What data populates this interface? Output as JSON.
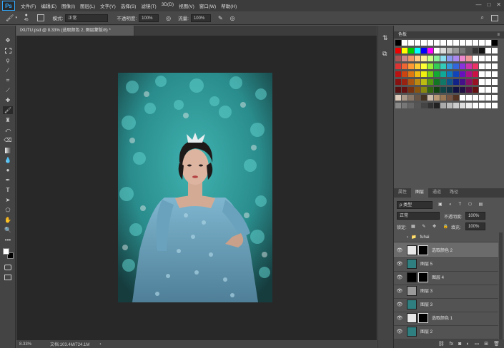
{
  "app": {
    "logo": "Ps"
  },
  "menu": [
    "文件(F)",
    "编辑(E)",
    "图像(I)",
    "图层(L)",
    "文字(Y)",
    "选择(S)",
    "滤镜(T)",
    "3D(D)",
    "视图(V)",
    "窗口(W)",
    "帮助(H)"
  ],
  "window_controls": [
    "—",
    "□",
    "✕"
  ],
  "options": {
    "brush_size": "45",
    "mode_label": "模式:",
    "mode_value": "正常",
    "opacity_label": "不透明度:",
    "opacity_value": "100%",
    "flow_label": "流量:",
    "flow_value": "100%"
  },
  "document": {
    "tab_title": "IXUTU.psd @ 8.33% (选取颜色 2, 图层蒙版/8) *",
    "zoom": "8.33%",
    "doc_info": "文档:103.4M/724.1M"
  },
  "panels": {
    "swatches_title": "色板",
    "layer_tabs": [
      "图层",
      "通道",
      "路径"
    ],
    "layer_tab_first": "属性",
    "kind_label": "ρ 类型",
    "blend_mode": "正常",
    "opacity_label": "不透明度:",
    "opacity_value": "100%",
    "lock_label": "锁定:",
    "fill_label": "填充:",
    "fill_value": "100%"
  },
  "layers": [
    {
      "name": "fuhai",
      "type": "group",
      "selected": false
    },
    {
      "name": "选取颜色 2",
      "type": "adjustment",
      "selected": true
    },
    {
      "name": "图层 5",
      "type": "photo",
      "selected": false
    },
    {
      "name": "图层 4",
      "type": "mask",
      "selected": false
    },
    {
      "name": "图层 3",
      "type": "gray",
      "selected": false
    },
    {
      "name": "图层 3",
      "type": "photo",
      "selected": false
    },
    {
      "name": "选取颜色 1",
      "type": "adjustment",
      "selected": false
    },
    {
      "name": "图层 2",
      "type": "photo",
      "selected": false
    }
  ],
  "colors": {
    "accent": "#31a8ff",
    "canvas_bg": "#282828",
    "panel_bg": "#535353",
    "photo_teal": "#2fa6a6"
  }
}
